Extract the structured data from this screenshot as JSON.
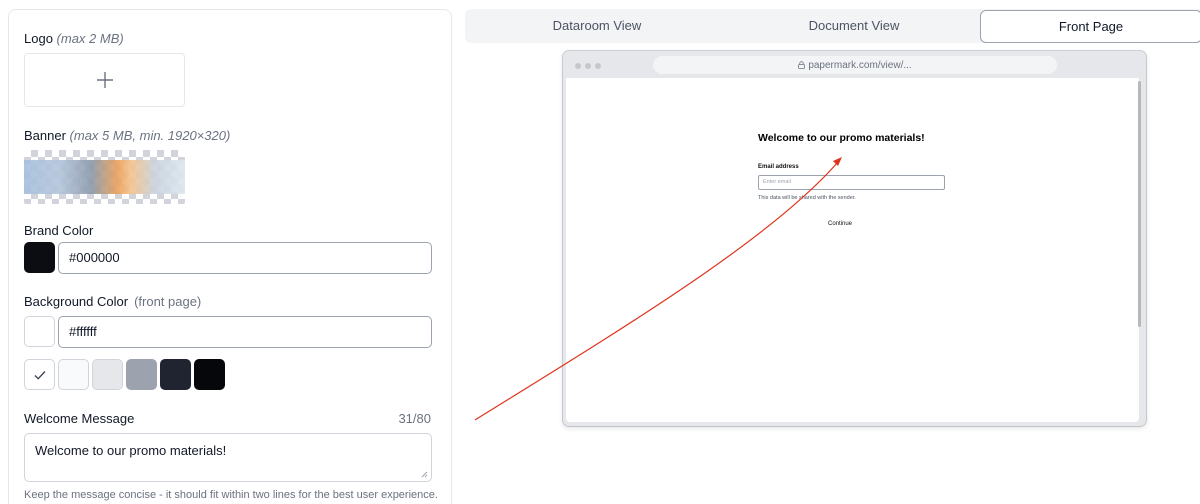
{
  "settings": {
    "logo": {
      "label": "Logo",
      "hint": "(max 2 MB)",
      "add_symbol": "+"
    },
    "banner": {
      "label": "Banner",
      "hint": "(max 5 MB, min. 1920×320)"
    },
    "brand_color": {
      "label": "Brand Color",
      "value": "#000000",
      "swatch": "#0b0d12"
    },
    "background_color": {
      "label": "Background Color",
      "sublabel": "(front page)",
      "value": "#ffffff",
      "swatch": "#ffffff",
      "presets": [
        {
          "color": "#ffffff",
          "selected": true
        },
        {
          "color": "#f9fafb",
          "selected": false
        },
        {
          "color": "#e5e7eb",
          "selected": false
        },
        {
          "color": "#9ca3af",
          "selected": false
        },
        {
          "color": "#1f2430",
          "selected": false
        },
        {
          "color": "#05070b",
          "selected": false
        }
      ]
    },
    "welcome_message": {
      "label": "Welcome Message",
      "counter": "31/80",
      "value": "Welcome to our promo materials!",
      "hint": "Keep the message concise - it should fit within two lines for the best user experience."
    }
  },
  "tabs": [
    {
      "label": "Dataroom View",
      "active": false
    },
    {
      "label": "Document View",
      "active": false
    },
    {
      "label": "Front Page",
      "active": true
    }
  ],
  "preview": {
    "url": "papermark.com/view/...",
    "title": "Welcome to our promo materials!",
    "email_label": "Email address",
    "email_placeholder": "Enter email",
    "note": "This data will be shared with the sender.",
    "button": "Continue"
  },
  "annotation": {
    "arrow_color": "#e0321c"
  }
}
